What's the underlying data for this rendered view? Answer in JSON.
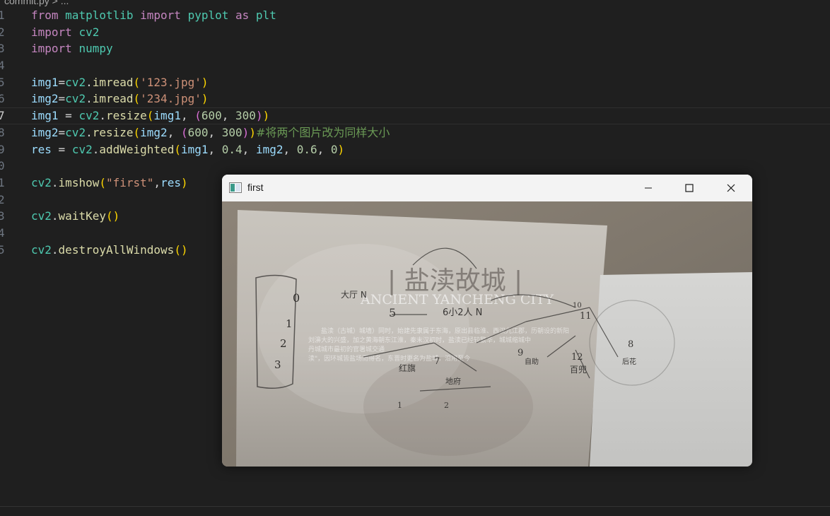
{
  "editor": {
    "breadcrumb": "commit.py > ...",
    "line_numbers": [
      "1",
      "2",
      "3",
      "4",
      "5",
      "6",
      "7",
      "8",
      "9",
      "0",
      "1",
      "2",
      "3",
      "4",
      "5"
    ],
    "current_line_index": 6,
    "lines": [
      [
        {
          "t": "from",
          "c": "kw"
        },
        {
          "t": " ",
          "c": "op"
        },
        {
          "t": "matplotlib",
          "c": "mod"
        },
        {
          "t": " ",
          "c": "op"
        },
        {
          "t": "import",
          "c": "kw"
        },
        {
          "t": " ",
          "c": "op"
        },
        {
          "t": "pyplot",
          "c": "mod"
        },
        {
          "t": " ",
          "c": "op"
        },
        {
          "t": "as",
          "c": "kw"
        },
        {
          "t": " ",
          "c": "op"
        },
        {
          "t": "plt",
          "c": "mod"
        }
      ],
      [
        {
          "t": "import",
          "c": "kw"
        },
        {
          "t": " ",
          "c": "op"
        },
        {
          "t": "cv2",
          "c": "mod"
        }
      ],
      [
        {
          "t": "import",
          "c": "kw"
        },
        {
          "t": " ",
          "c": "op"
        },
        {
          "t": "numpy",
          "c": "mod"
        }
      ],
      [],
      [
        {
          "t": "img1",
          "c": "var"
        },
        {
          "t": "=",
          "c": "op"
        },
        {
          "t": "cv2",
          "c": "mod"
        },
        {
          "t": ".",
          "c": "op"
        },
        {
          "t": "imread",
          "c": "fn"
        },
        {
          "t": "(",
          "c": "p1"
        },
        {
          "t": "'123.jpg'",
          "c": "str"
        },
        {
          "t": ")",
          "c": "p1"
        }
      ],
      [
        {
          "t": "img2",
          "c": "var"
        },
        {
          "t": "=",
          "c": "op"
        },
        {
          "t": "cv2",
          "c": "mod"
        },
        {
          "t": ".",
          "c": "op"
        },
        {
          "t": "imread",
          "c": "fn"
        },
        {
          "t": "(",
          "c": "p1"
        },
        {
          "t": "'234.jpg'",
          "c": "str"
        },
        {
          "t": ")",
          "c": "p1"
        }
      ],
      [
        {
          "t": "img1",
          "c": "var"
        },
        {
          "t": " = ",
          "c": "op"
        },
        {
          "t": "cv2",
          "c": "mod"
        },
        {
          "t": ".",
          "c": "op"
        },
        {
          "t": "resize",
          "c": "fn"
        },
        {
          "t": "(",
          "c": "p1"
        },
        {
          "t": "img1",
          "c": "var"
        },
        {
          "t": ", ",
          "c": "op"
        },
        {
          "t": "(",
          "c": "p2"
        },
        {
          "t": "600",
          "c": "num"
        },
        {
          "t": ", ",
          "c": "op"
        },
        {
          "t": "300",
          "c": "num"
        },
        {
          "t": ")",
          "c": "p2"
        },
        {
          "t": ")",
          "c": "p1"
        }
      ],
      [
        {
          "t": "img2",
          "c": "var"
        },
        {
          "t": "=",
          "c": "op"
        },
        {
          "t": "cv2",
          "c": "mod"
        },
        {
          "t": ".",
          "c": "op"
        },
        {
          "t": "resize",
          "c": "fn"
        },
        {
          "t": "(",
          "c": "p1"
        },
        {
          "t": "img2",
          "c": "var"
        },
        {
          "t": ", ",
          "c": "op"
        },
        {
          "t": "(",
          "c": "p2"
        },
        {
          "t": "600",
          "c": "num"
        },
        {
          "t": ", ",
          "c": "op"
        },
        {
          "t": "300",
          "c": "num"
        },
        {
          "t": ")",
          "c": "p2"
        },
        {
          "t": ")",
          "c": "p1"
        },
        {
          "t": "#将两个图片改为同样大小",
          "c": "cmt"
        }
      ],
      [
        {
          "t": "res",
          "c": "var"
        },
        {
          "t": " = ",
          "c": "op"
        },
        {
          "t": "cv2",
          "c": "mod"
        },
        {
          "t": ".",
          "c": "op"
        },
        {
          "t": "addWeighted",
          "c": "fn"
        },
        {
          "t": "(",
          "c": "p1"
        },
        {
          "t": "img1",
          "c": "var"
        },
        {
          "t": ", ",
          "c": "op"
        },
        {
          "t": "0.4",
          "c": "num"
        },
        {
          "t": ", ",
          "c": "op"
        },
        {
          "t": "img2",
          "c": "var"
        },
        {
          "t": ", ",
          "c": "op"
        },
        {
          "t": "0.6",
          "c": "num"
        },
        {
          "t": ", ",
          "c": "op"
        },
        {
          "t": "0",
          "c": "num"
        },
        {
          "t": ")",
          "c": "p1"
        }
      ],
      [],
      [
        {
          "t": "cv2",
          "c": "mod"
        },
        {
          "t": ".",
          "c": "op"
        },
        {
          "t": "imshow",
          "c": "fn"
        },
        {
          "t": "(",
          "c": "p1"
        },
        {
          "t": "\"first\"",
          "c": "str"
        },
        {
          "t": ",",
          "c": "op"
        },
        {
          "t": "res",
          "c": "var"
        },
        {
          "t": ")",
          "c": "p1"
        }
      ],
      [],
      [
        {
          "t": "cv2",
          "c": "mod"
        },
        {
          "t": ".",
          "c": "op"
        },
        {
          "t": "waitKey",
          "c": "fn"
        },
        {
          "t": "(",
          "c": "p1"
        },
        {
          "t": ")",
          "c": "p1"
        }
      ],
      [],
      [
        {
          "t": "cv2",
          "c": "mod"
        },
        {
          "t": ".",
          "c": "op"
        },
        {
          "t": "destroyAllWindows",
          "c": "fn"
        },
        {
          "t": "(",
          "c": "p1"
        },
        {
          "t": ")",
          "c": "p1"
        }
      ]
    ]
  },
  "window": {
    "title": "first",
    "icons": {
      "app": "app-icon",
      "minimize": "minimize-icon",
      "maximize": "maximize-icon",
      "close": "close-icon"
    }
  },
  "image": {
    "title_cn": "| 盐渎故城 |",
    "title_en": "ANCIENT YANCHENG CITY",
    "body_line1": "盐渎（古城）城墙）同时，始建先隶属于东海，原出县临淮、西汉九江郡，历朝设的新阳",
    "body_line2": "刘濞大的兴盛，加之黄海朝东江淮，秦末汉初时，盐渎已经较繁华，城城缩城中",
    "body_line3": "丹城城市最初的官署城交通",
    "body_line4": "渎\"，因环城皆盐场而得名，东晋时更名为盐城，沿用至今",
    "hand": {
      "n0": "0",
      "n1": "1",
      "n2": "2",
      "n3": "3",
      "n5": "5",
      "n6": "6小2人 N",
      "n10": "10",
      "n11": "11",
      "n12": "12",
      "n7": "7",
      "n8": "8",
      "n9": "9",
      "lbl_a": "大厅 N",
      "lbl_b": "红旗",
      "lbl_c": "地府",
      "lbl_d": "百兜",
      "lbl_e": "1",
      "lbl_f": "2",
      "lbl_g": "自助",
      "lbl_h": "后花"
    }
  }
}
